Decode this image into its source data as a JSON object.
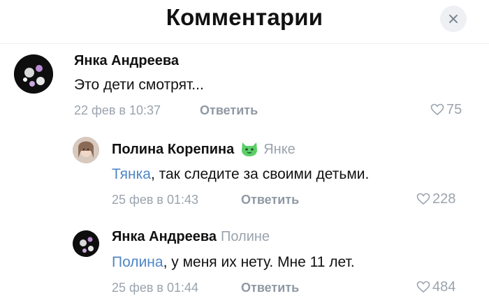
{
  "header": {
    "title": "Комментарии",
    "close_icon": "close-icon"
  },
  "comments": [
    {
      "author": "Янка Андреева",
      "text": "Это дети смотрят...",
      "time": "22 фев в 10:37",
      "reply_label": "Ответить",
      "likes": "75"
    },
    {
      "author": "Полина Корепина",
      "emoji_icon": "green-cat-emoji-icon",
      "reply_to": "Янке",
      "mention": "Тянка",
      "text": ", так следите за своими детьми.",
      "time": "25 фев в 01:43",
      "reply_label": "Ответить",
      "likes": "228"
    },
    {
      "author": "Янка Андреева",
      "reply_to": "Полине",
      "mention": "Полина",
      "text": ", у меня их нету. Мне 11 лет.",
      "time": "25 фев в 01:44",
      "reply_label": "Ответить",
      "likes": "484"
    }
  ],
  "colors": {
    "link": "#4f86c6",
    "secondary": "#9aa3ad",
    "divider": "#eceef1"
  }
}
